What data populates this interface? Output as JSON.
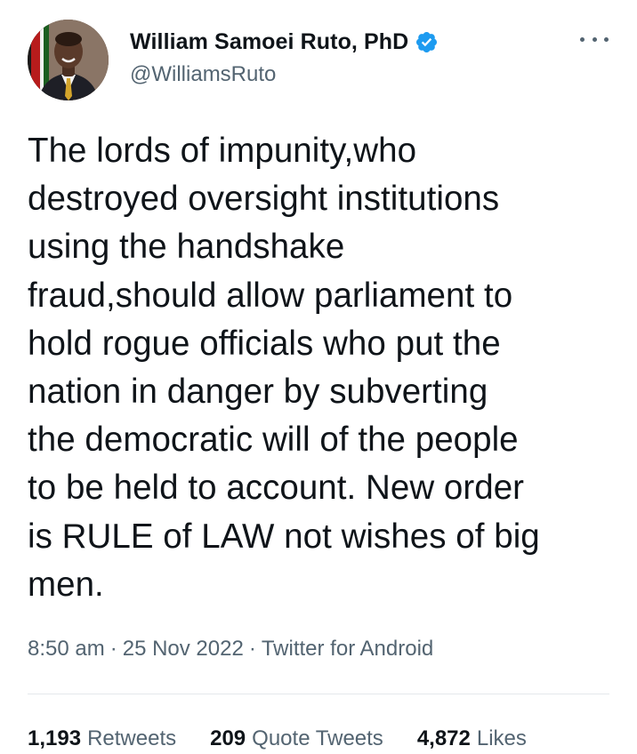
{
  "author": {
    "display_name": "William Samoei Ruto, PhD",
    "handle": "@WilliamsRuto",
    "verified": true
  },
  "tweet": {
    "text": "The lords of impunity,who\ndestroyed oversight institutions\nusing the handshake\nfraud,should allow parliament to\nhold rogue officials who put the\nnation in danger by subverting\nthe democratic will of the people\nto be held to account. New order\nis RULE of LAW not wishes of big\nmen.",
    "time": "8:50 am",
    "date": "25 Nov 2022",
    "source": "Twitter for Android",
    "separator": "·"
  },
  "stats": {
    "retweets_count": "1,193",
    "retweets_label": "Retweets",
    "quote_tweets_count": "209",
    "quote_tweets_label": "Quote Tweets",
    "likes_count": "4,872",
    "likes_label": "Likes"
  },
  "icons": {
    "verified": "verified-badge-icon",
    "more": "more-options-icon"
  },
  "colors": {
    "text_primary": "#0f1419",
    "text_secondary": "#536471",
    "verified_blue": "#1d9bf0",
    "divider": "#e4e8eb"
  }
}
